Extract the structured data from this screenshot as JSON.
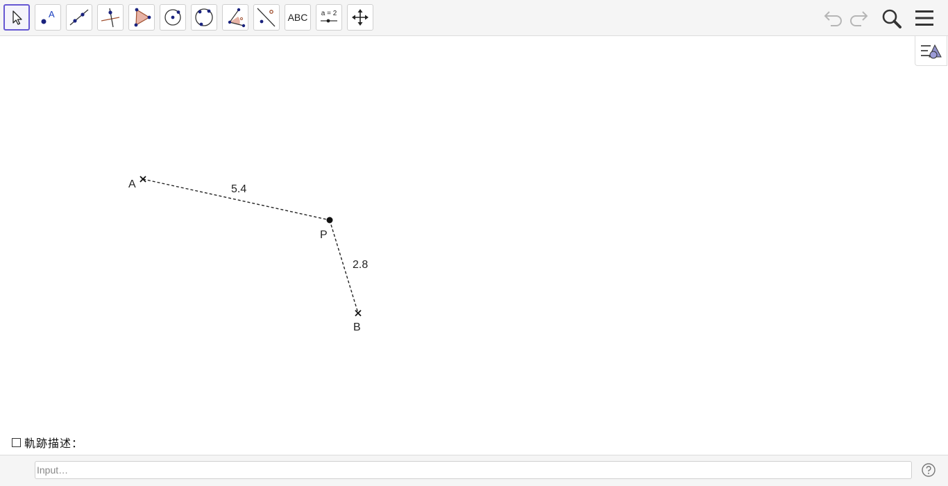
{
  "toolbar": {
    "tools": [
      {
        "name": "move-tool",
        "icon": "cursor-arrow-icon",
        "selected": true
      },
      {
        "name": "point-tool",
        "icon": "point-icon",
        "glyph": "A"
      },
      {
        "name": "line-tool",
        "icon": "line-icon"
      },
      {
        "name": "perpendicular-line-tool",
        "icon": "perpendicular-line-icon"
      },
      {
        "name": "polygon-tool",
        "icon": "polygon-icon"
      },
      {
        "name": "circle-with-center-tool",
        "icon": "circle-center-icon"
      },
      {
        "name": "circle-through-points-tool",
        "icon": "circle-three-points-icon"
      },
      {
        "name": "angle-tool",
        "icon": "angle-icon"
      },
      {
        "name": "reflect-tool",
        "icon": "reflect-icon"
      },
      {
        "name": "text-tool",
        "icon": "text-icon",
        "text": "ABC"
      },
      {
        "name": "slider-tool",
        "icon": "slider-icon",
        "text": "a = 2"
      },
      {
        "name": "move-graphics-view-tool",
        "icon": "move-arrows-icon"
      }
    ],
    "undo_icon": "undo-icon",
    "redo_icon": "redo-icon",
    "search_icon": "search-icon",
    "menu_icon": "hamburger-menu-icon",
    "accent_color": "#6557d2"
  },
  "side_panel": {
    "icon": "algebra-view-icon"
  },
  "graphics": {
    "points": [
      {
        "label": "A",
        "style": "cross"
      },
      {
        "label": "P",
        "style": "dot"
      },
      {
        "label": "B",
        "style": "cross"
      }
    ],
    "segments": [
      {
        "from": "A",
        "to": "P",
        "length_label": "5.4",
        "style": "dashed"
      },
      {
        "from": "P",
        "to": "B",
        "length_label": "2.8",
        "style": "dashed"
      }
    ]
  },
  "checkbox": {
    "label": "軌跡描述：",
    "checked": false
  },
  "input_bar": {
    "placeholder": "Input…",
    "value": "",
    "help_icon": "help-icon"
  }
}
